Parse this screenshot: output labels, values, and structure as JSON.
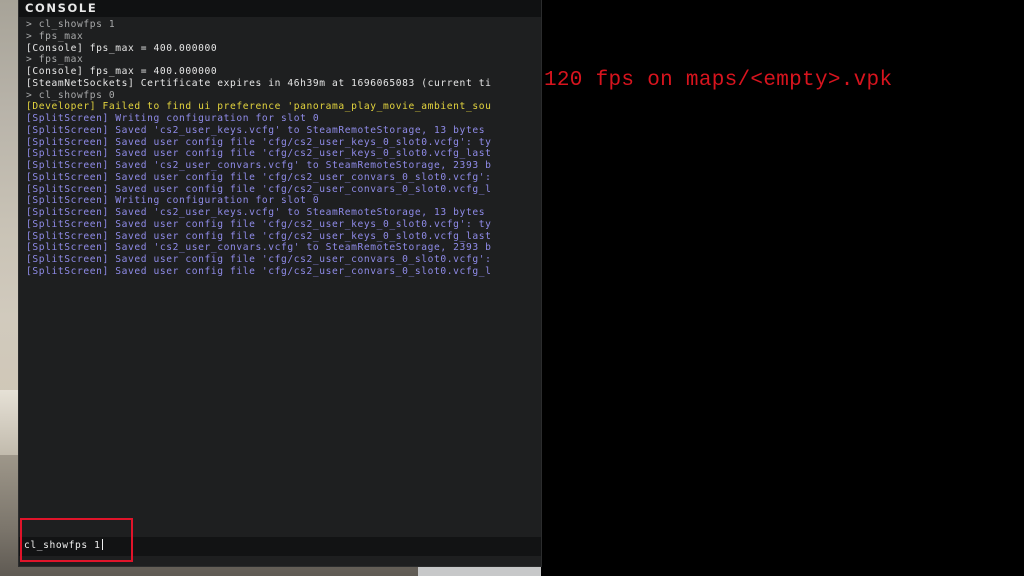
{
  "console": {
    "title": "CONSOLE",
    "log": [
      {
        "text": "> cl_showfps 1",
        "color": "#a9aaab"
      },
      {
        "text": "> fps_max",
        "color": "#a9aaab"
      },
      {
        "text": "[Console] fps_max = 400.000000",
        "color": "#e7e7e7"
      },
      {
        "text": "> fps_max",
        "color": "#a9aaab"
      },
      {
        "text": "[Console] fps_max = 400.000000",
        "color": "#e7e7e7"
      },
      {
        "text": "[SteamNetSockets] Certificate expires in 46h39m at 1696065083 (current ti",
        "color": "#e7e7e7"
      },
      {
        "text": "> cl_showfps 0",
        "color": "#a9aaab"
      },
      {
        "text": "[Developer] Failed to find ui preference 'panorama_play_movie_ambient_sou",
        "color": "#e3d43e"
      },
      {
        "text": "[SplitScreen] Writing configuration for slot 0",
        "color": "#8f8be8"
      },
      {
        "text": "[SplitScreen] Saved 'cs2_user_keys.vcfg' to SteamRemoteStorage, 13 bytes",
        "color": "#8f8be8"
      },
      {
        "text": "[SplitScreen] Saved user config file 'cfg/cs2_user_keys_0_slot0.vcfg': ty",
        "color": "#8f8be8"
      },
      {
        "text": "[SplitScreen] Saved user config file 'cfg/cs2_user_keys_0_slot0.vcfg_last",
        "color": "#8f8be8"
      },
      {
        "text": "[SplitScreen] Saved 'cs2_user_convars.vcfg' to SteamRemoteStorage, 2393 b",
        "color": "#8f8be8"
      },
      {
        "text": "[SplitScreen] Saved user config file 'cfg/cs2_user_convars_0_slot0.vcfg':",
        "color": "#8f8be8"
      },
      {
        "text": "[SplitScreen] Saved user config file 'cfg/cs2_user_convars_0_slot0.vcfg_l",
        "color": "#8f8be8"
      },
      {
        "text": "[SplitScreen] Writing configuration for slot 0",
        "color": "#8f8be8"
      },
      {
        "text": "[SplitScreen] Saved 'cs2_user_keys.vcfg' to SteamRemoteStorage, 13 bytes",
        "color": "#8f8be8"
      },
      {
        "text": "[SplitScreen] Saved user config file 'cfg/cs2_user_keys_0_slot0.vcfg': ty",
        "color": "#8f8be8"
      },
      {
        "text": "[SplitScreen] Saved user config file 'cfg/cs2_user_keys_0_slot0.vcfg_last",
        "color": "#8f8be8"
      },
      {
        "text": "[SplitScreen] Saved 'cs2_user_convars.vcfg' to SteamRemoteStorage, 2393 b",
        "color": "#8f8be8"
      },
      {
        "text": "[SplitScreen] Saved user config file 'cfg/cs2_user_convars_0_slot0.vcfg':",
        "color": "#8f8be8"
      },
      {
        "text": "[SplitScreen] Saved user config file 'cfg/cs2_user_convars_0_slot0.vcfg_l",
        "color": "#8f8be8"
      }
    ],
    "input": {
      "value": "cl_showfps 1"
    }
  },
  "overlay": {
    "fps_text": "120 fps on maps/<empty>.vpk",
    "color": "#d8141e"
  },
  "annotation": {
    "highlight_color": "#e0142a"
  }
}
